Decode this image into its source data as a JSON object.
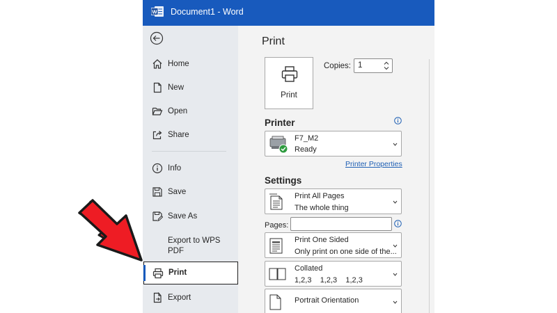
{
  "titlebar": {
    "title": "Document1 - Word"
  },
  "nav": {
    "items": [
      {
        "label": "Home",
        "icon": "home-icon"
      },
      {
        "label": "New",
        "icon": "new-document-icon"
      },
      {
        "label": "Open",
        "icon": "folder-open-icon"
      },
      {
        "label": "Share",
        "icon": "share-icon"
      },
      {
        "label": "Info",
        "icon": "info-icon"
      },
      {
        "label": "Save",
        "icon": "save-icon"
      },
      {
        "label": "Save As",
        "icon": "save-as-icon"
      },
      {
        "label": "Export to WPS PDF",
        "icon": ""
      },
      {
        "label": "Print",
        "icon": "printer-icon",
        "selected": true
      },
      {
        "label": "Export",
        "icon": "export-icon"
      }
    ]
  },
  "print": {
    "heading": "Print",
    "button_label": "Print",
    "copies_label": "Copies:",
    "copies_value": "1"
  },
  "printer": {
    "heading": "Printer",
    "name": "F7_M2",
    "status": "Ready",
    "properties_link": "Printer Properties"
  },
  "settings": {
    "heading": "Settings",
    "pages_label": "Pages:",
    "pages_value": "",
    "options": [
      {
        "line1": "Print All Pages",
        "line2": "The whole thing",
        "icon": "pages-icon"
      },
      {
        "line1": "Print One Sided",
        "line2": "Only print on one side of the...",
        "icon": "one-sided-icon"
      },
      {
        "line1": "Collated",
        "line2": "1,2,3    1,2,3    1,2,3",
        "icon": "collated-icon"
      },
      {
        "line1": "Portrait Orientation",
        "line2": "",
        "icon": "portrait-icon"
      }
    ]
  },
  "colors": {
    "title_bar": "#185abd",
    "backstage": "#e7eaee",
    "content": "#f3f3f3",
    "link": "#1e5fb4",
    "arrow": "#ee1c24"
  }
}
